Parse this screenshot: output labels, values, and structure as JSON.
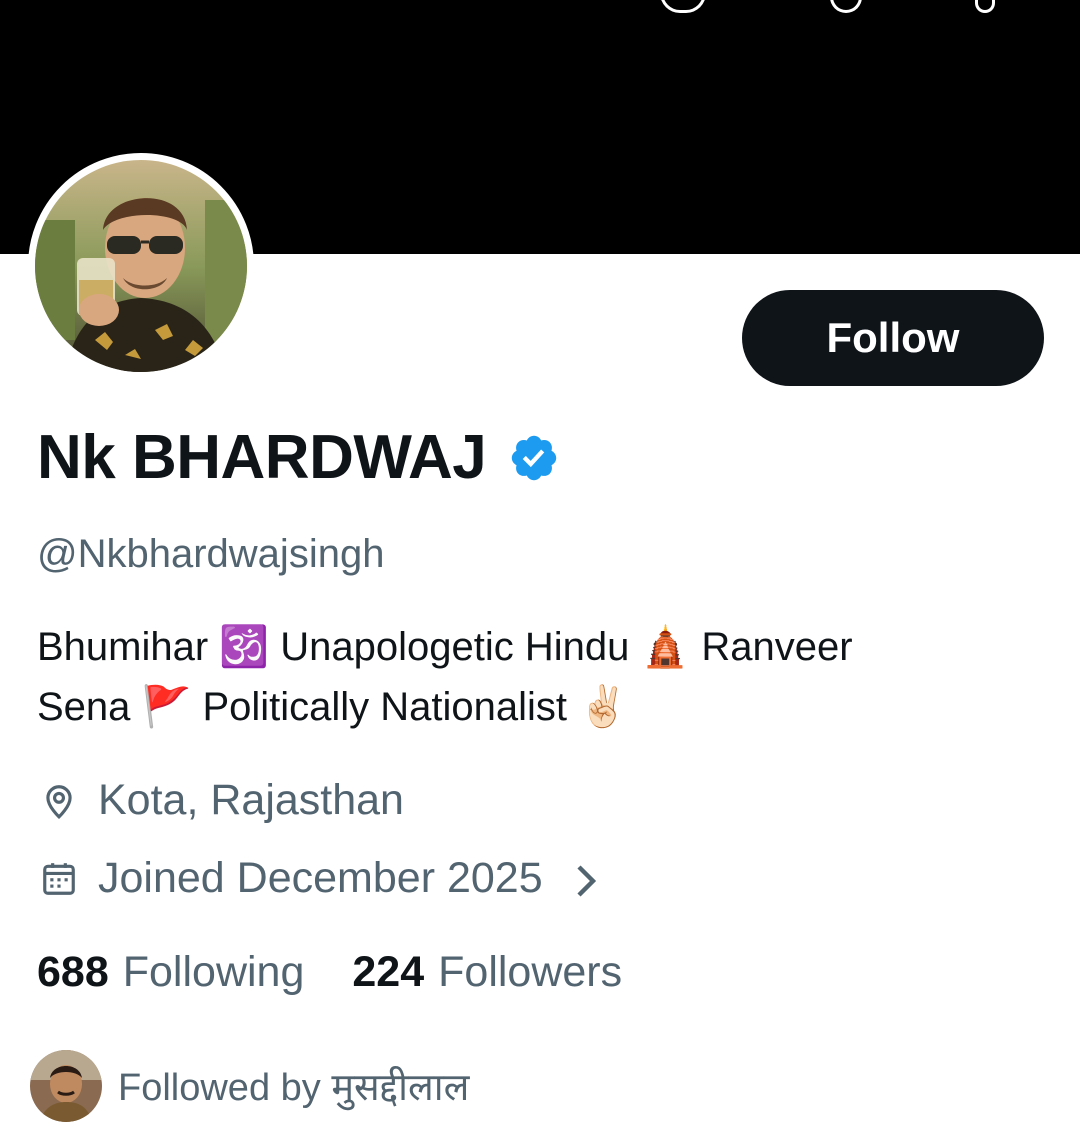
{
  "profile": {
    "display_name": "Nk BHARDWAJ",
    "handle": "@Nkbhardwajsingh",
    "verified": true,
    "bio_line1": "Bhumihar 🕉️ Unapologetic Hindu 🛕 Ranveer",
    "bio_line2": "Sena 🚩  Politically Nationalist ✌🏻",
    "location": "Kota, Rajasthan",
    "joined": "Joined December 2025"
  },
  "actions": {
    "follow_label": "Follow"
  },
  "stats": {
    "following_count": "688",
    "following_label": "Following",
    "followers_count": "224",
    "followers_label": "Followers"
  },
  "followed_by": {
    "text": "Followed by मुसद्दीलाल"
  },
  "colors": {
    "text_primary": "#0f1419",
    "text_secondary": "#536471",
    "verified_blue": "#1d9bf0",
    "banner": "#000000",
    "button_bg": "#0f1419"
  },
  "icons": [
    "verified-badge-icon",
    "location-pin-icon",
    "calendar-icon",
    "chevron-right-icon"
  ]
}
